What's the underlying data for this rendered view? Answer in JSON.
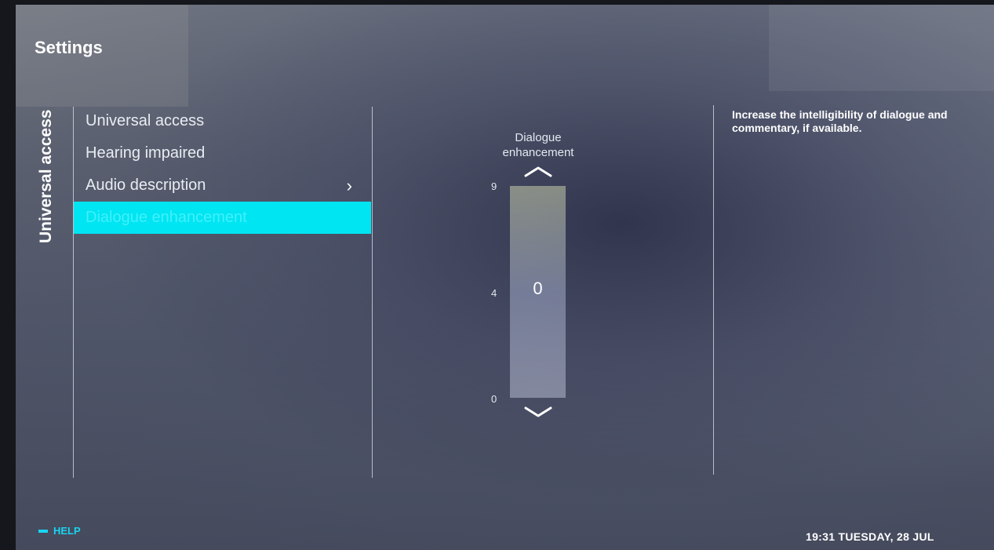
{
  "header": {
    "title": "Settings"
  },
  "section": {
    "label": "Universal access"
  },
  "menu": {
    "items": [
      {
        "label": "Universal access"
      },
      {
        "label": "Hearing impaired"
      },
      {
        "label": "Audio description"
      },
      {
        "label": "Dialogue enhancement"
      }
    ],
    "selected_index": 3
  },
  "slider": {
    "title": "Dialogue enhancement",
    "value": "0",
    "max_label": "9",
    "mid_label": "4",
    "min_label": "0"
  },
  "description": "Increase the intelligibility of dialogue and commentary, if available.",
  "footer": {
    "help_label": "HELP",
    "clock": "19:31 TUESDAY, 28 JUL"
  },
  "colors": {
    "selection": "#00e5f2",
    "help": "#19d4f0"
  }
}
